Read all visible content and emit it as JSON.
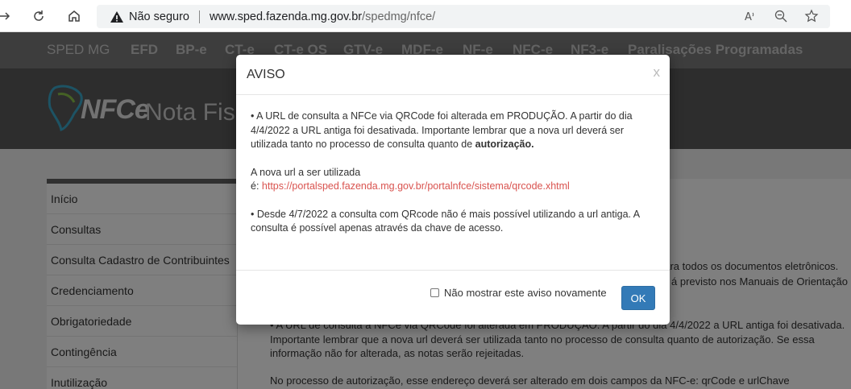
{
  "browser": {
    "security_label": "Não seguro",
    "url_host": "www.sped.fazenda.mg.gov.br",
    "url_path": "/spedmg/nfce/"
  },
  "site_nav": {
    "brand": "SPED MG",
    "items": [
      "EFD",
      "BP-e",
      "CT-e",
      "CT-e OS",
      "GTV-e",
      "MDF-e",
      "NF-e",
      "NFC-e",
      "NF3-e",
      "Paralisações Programadas"
    ]
  },
  "header": {
    "logo_text": "NFCe",
    "title": "Nota Fisc"
  },
  "sidebar": {
    "items": [
      "Início",
      "Consultas",
      "Consulta Cadastro de Contribuintes",
      "Credenciamento",
      "Obrigatoriedade",
      "Contingência",
      "Inutilização"
    ]
  },
  "content": {
    "line1": "para todos os documentos eletrônicos.",
    "line2": "á previsto nos Manuais de Orientação",
    "line3": "• A URL de consulta a NFCe via QRCode foi alterada em PRODUÇÃO. A partir do dia 4/4/2022 a URL antiga foi desativada.",
    "line4": "Importante lembrar que a nova url deverá ser utilizada tanto no processo de consulta quanto de autorização. Se essa",
    "line5": "informação não for alterada, as notas serão rejeitadas.",
    "line6": "No processo de autorização, esse endereço deverá ser alterado em dois campos da NFC-e: qrCode e urlChave"
  },
  "modal": {
    "title": "AVISO",
    "close": "x",
    "p1_text": "• A URL de consulta a NFCe via QRCode foi alterada em PRODUÇÃO. A partir do dia 4/4/2022 a URL antiga foi desativada. Importante lembrar que a nova url deverá ser utilizada tanto no processo de consulta quanto de ",
    "p1_bold": "autorização.",
    "p2_label": "A nova url a ser utilizada",
    "p2_prefix": "é: ",
    "p2_link": "https://portalsped.fazenda.mg.gov.br/portalnfce/sistema/qrcode.xhtml",
    "p3_text": "• Desde 4/7/2022 a consulta com QRcode não é mais possível utilizando a url antiga. A consulta é possível apenas através da chave de acesso.",
    "checkbox_label": "Não mostrar este aviso novamente",
    "ok_label": "OK"
  },
  "colors": {
    "primary_button": "#337ab7",
    "link": "#d9534f"
  }
}
